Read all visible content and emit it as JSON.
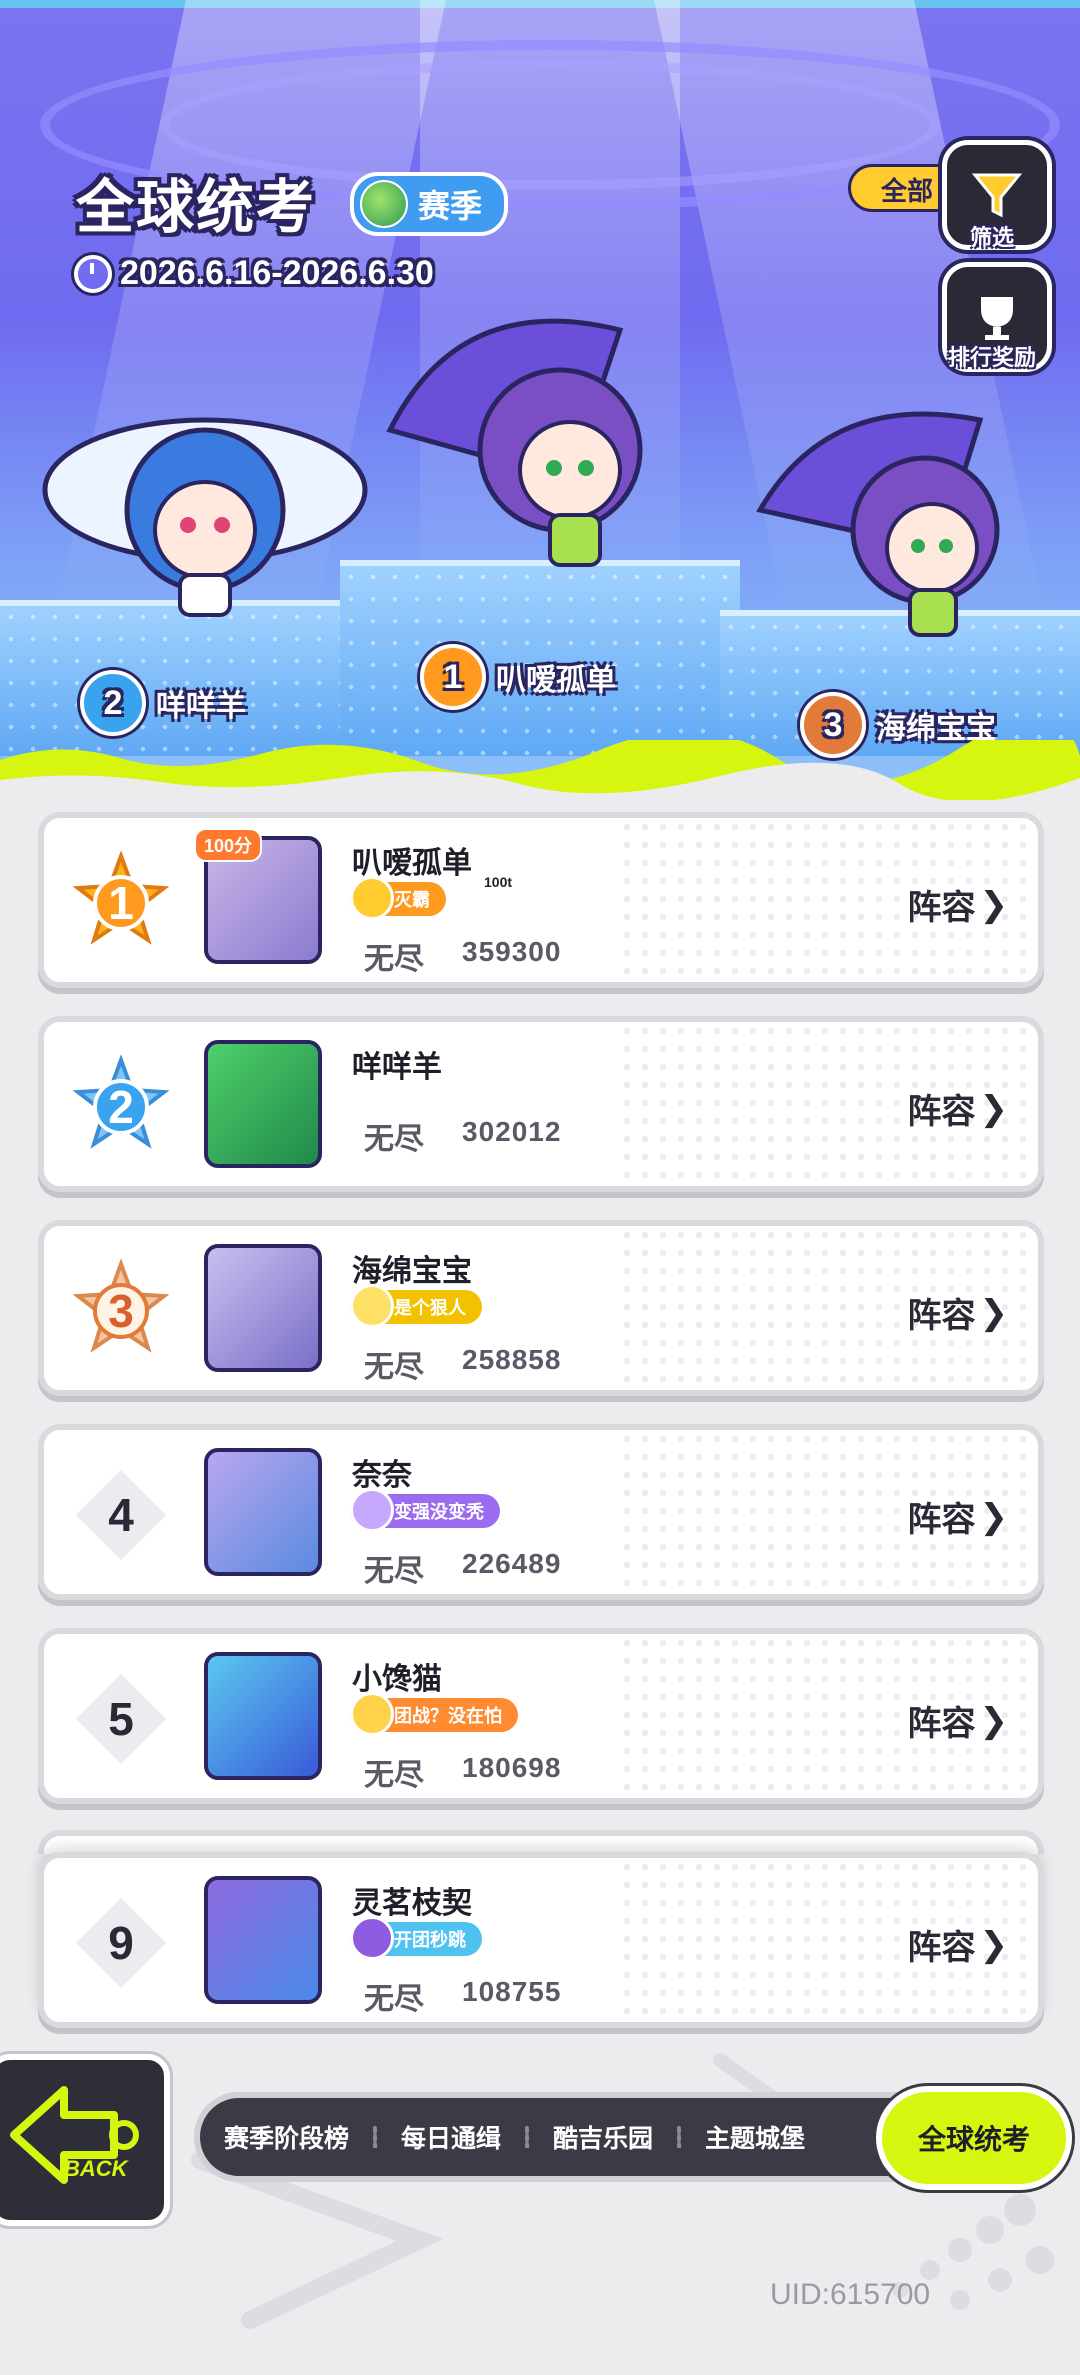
{
  "header": {
    "title": "全球统考",
    "season_label": "赛季",
    "date_range": "2026.6.16-2026.6.30",
    "filter_value": "全部",
    "filter_label": "筛选",
    "rewards_label": "排行奖励"
  },
  "podium": [
    {
      "rank": "2",
      "name": "咩咩羊"
    },
    {
      "rank": "1",
      "name": "叭嗳孤单"
    },
    {
      "rank": "3",
      "name": "海绵宝宝"
    }
  ],
  "leaderboard": [
    {
      "rank": "1",
      "name": "叭嗳孤单",
      "title_badge": "灭霸",
      "badge_note": "100分",
      "badge_sub": "100t",
      "mode": "无尽",
      "score": "359300",
      "action": "阵容"
    },
    {
      "rank": "2",
      "name": "咩咩羊",
      "mode": "无尽",
      "score": "302012",
      "action": "阵容"
    },
    {
      "rank": "3",
      "name": "海绵宝宝",
      "title_badge": "是个狠人",
      "mode": "无尽",
      "score": "258858",
      "action": "阵容"
    },
    {
      "rank": "4",
      "name": "奈奈",
      "title_badge": "变强没变秃",
      "mode": "无尽",
      "score": "226489",
      "action": "阵容"
    },
    {
      "rank": "5",
      "name": "小馋猫",
      "title_badge": "团战？没在怕",
      "mode": "无尽",
      "score": "180698",
      "action": "阵容"
    },
    {
      "rank": "9",
      "name": "灵茗枝契",
      "title_badge": "开团秒跳",
      "mode": "无尽",
      "score": "108755",
      "action": "阵容"
    }
  ],
  "nav": {
    "tabs": [
      "赛季阶段榜",
      "每日通缉",
      "酷吉乐园",
      "主题城堡"
    ],
    "active": "全球统考"
  },
  "back_label": "BACK",
  "uid": "UID:615700",
  "colors": {
    "accent_lime": "#d6f50f",
    "gold": "#ffcb2f",
    "dark": "#2a2560",
    "sky": "#6f6bf0"
  },
  "icons": [
    "clock-icon",
    "globe-icon",
    "filter-icon",
    "trophy-icon",
    "chevron-right-icon",
    "back-arrow-icon"
  ]
}
